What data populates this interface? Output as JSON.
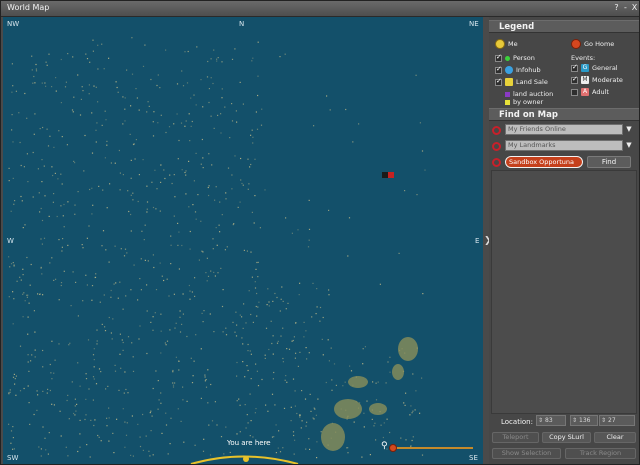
{
  "window": {
    "title": "World Map",
    "help_label": "?",
    "minimize_label": "-",
    "close_label": "X"
  },
  "map": {
    "compass": {
      "nw": "NW",
      "n": "N",
      "ne": "NE",
      "w": "W",
      "e": "E",
      "sw": "SW",
      "se": "SE"
    },
    "you_are_here": "You are here",
    "colors": {
      "water": "#13506a",
      "land_dots": "#c9c08a",
      "zoom": "#c58a2a"
    }
  },
  "legend": {
    "header": "Legend",
    "me": "Me",
    "go_home": "Go Home",
    "person": "Person",
    "infohub": "Infohub",
    "land_sale": "Land Sale",
    "land_auction": "land auction",
    "by_owner": "by owner",
    "events_label": "Events:",
    "general": "General",
    "moderate": "Moderate",
    "adult": "Adult",
    "event_letters": {
      "general": "G",
      "moderate": "M",
      "adult": "A"
    }
  },
  "find": {
    "header": "Find on Map",
    "friends_value": "My Friends Online",
    "landmarks_value": "My Landmarks",
    "search_value": "Sandbox Opportuna",
    "find_label": "Find"
  },
  "location": {
    "label": "Location:",
    "x": "83",
    "y": "136",
    "z": "27"
  },
  "buttons": {
    "teleport": "Teleport",
    "copy_slurl": "Copy SLurl",
    "clear": "Clear",
    "show_selection": "Show Selection",
    "track_region": "Track Region"
  }
}
